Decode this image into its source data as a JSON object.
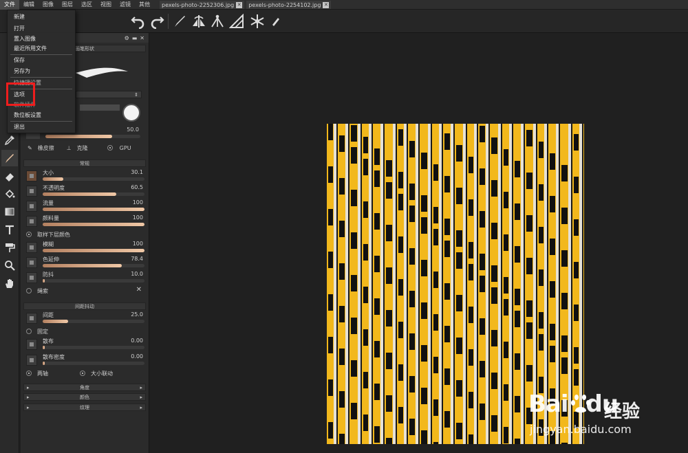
{
  "menubar": {
    "items": [
      "文件",
      "编辑",
      "图像",
      "图层",
      "选区",
      "视图",
      "滤镜",
      "其他"
    ],
    "active_index": 0
  },
  "tabs": [
    {
      "label": "pexels-photo-2252306.jpg"
    },
    {
      "label": "pexels-photo-2254102.jpg"
    }
  ],
  "file_menu": {
    "items": [
      "新建",
      "打开",
      "置入图像",
      "最近所用文件",
      "保存",
      "另存为",
      "快捷键设置",
      "选项",
      "软件插件",
      "数位板设置",
      "退出"
    ],
    "highlighted": "选项"
  },
  "panel": {
    "brush_shape_title": "画笔形状",
    "brush_opacity_value": "50.0",
    "tool_options": {
      "eraser": "橡皮擦",
      "clone": "克隆",
      "gpu": "GPU"
    },
    "general_title": "常规",
    "general_props": [
      {
        "label": "大小",
        "value": "30.1",
        "fill": 0.2
      },
      {
        "label": "不透明度",
        "value": "60.5",
        "fill": 0.72
      },
      {
        "label": "流量",
        "value": "100",
        "fill": 1.0
      },
      {
        "label": "颜料量",
        "value": "100",
        "fill": 1.0
      }
    ],
    "sample_layer": "取样下层颜色",
    "general_props2": [
      {
        "label": "模糊",
        "value": "100",
        "fill": 1.0
      },
      {
        "label": "色延伸",
        "value": "78.4",
        "fill": 0.78
      },
      {
        "label": "防抖",
        "value": "10.0",
        "fill": 0.02
      }
    ],
    "lasso": "绳索",
    "spacing_title": "间距抖动",
    "spacing_props": [
      {
        "label": "间距",
        "value": "25.0",
        "fill": 0.25
      }
    ],
    "fixed": "固定",
    "spacing_props2": [
      {
        "label": "散布",
        "value": "0.00",
        "fill": 0.01
      },
      {
        "label": "散布密度",
        "value": "0.00",
        "fill": 0.01
      }
    ],
    "both_axes": "两轴",
    "size_link": "大小联动",
    "collapsed_sections": [
      "角度",
      "颜色",
      "纹理"
    ]
  },
  "watermark": {
    "brand": "Bai",
    "brand_rest": "du",
    "cn": "经验",
    "url": "jingyan.baidu.com"
  },
  "colors": {
    "accent_highlight": "#ef1d1d",
    "stripe_yellow": "#f2b81c",
    "stripe_light": "#e6e1d6"
  }
}
